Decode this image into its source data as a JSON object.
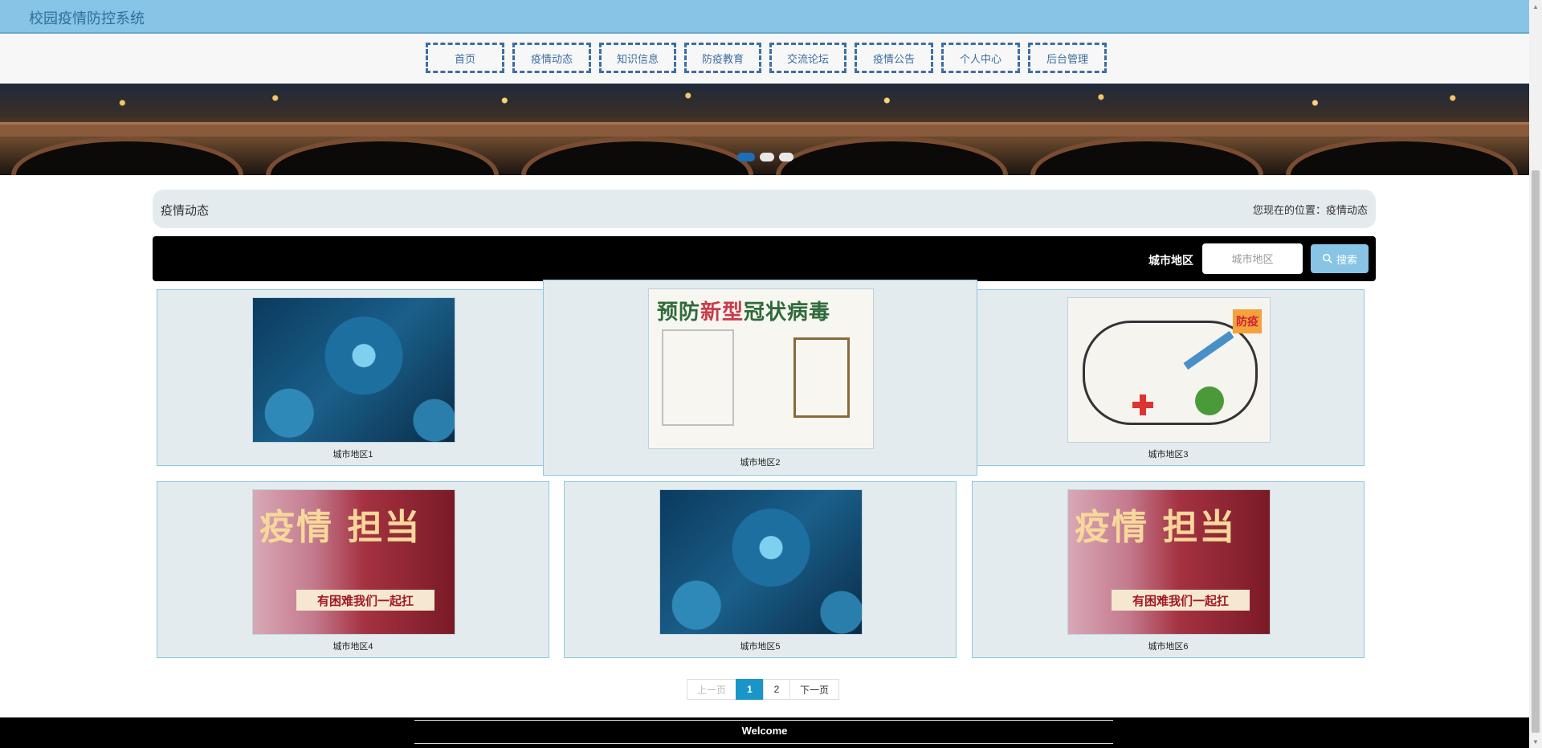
{
  "header": {
    "title": "校园疫情防控系统"
  },
  "nav": {
    "items": [
      {
        "label": "首页"
      },
      {
        "label": "疫情动态"
      },
      {
        "label": "知识信息"
      },
      {
        "label": "防疫教育"
      },
      {
        "label": "交流论坛"
      },
      {
        "label": "疫情公告"
      },
      {
        "label": "个人中心"
      },
      {
        "label": "后台管理"
      }
    ]
  },
  "banner": {
    "slide_count": 3,
    "active_slide": 1
  },
  "breadcrumb": {
    "title": "疫情动态",
    "location": "您现在的位置：疫情动态"
  },
  "search": {
    "label": "城市地区",
    "placeholder": "城市地区",
    "value": "",
    "button_label": "搜索"
  },
  "cards": [
    {
      "caption": "城市地区1",
      "image": "virus-image"
    },
    {
      "caption": "城市地区2",
      "image": "handdrawn-poster-image"
    },
    {
      "caption": "城市地区3",
      "image": "handdrawn-poster-image"
    },
    {
      "caption": "城市地区4",
      "image": "promo-banner-image"
    },
    {
      "caption": "城市地区5",
      "image": "virus-image"
    },
    {
      "caption": "城市地区6",
      "image": "promo-banner-image"
    }
  ],
  "poster": {
    "title_part1": "预防",
    "title_part2": "新型",
    "title_part3": "冠状病毒",
    "tag": "防疫"
  },
  "promo": {
    "headline": "疫情 担当",
    "strip": "有困难我们一起扛"
  },
  "pagination": {
    "prev": "上一页",
    "pages": [
      "1",
      "2"
    ],
    "current": "1",
    "next": "下一页"
  },
  "footer": {
    "text": "Welcome"
  },
  "colors": {
    "header_bg": "#87c4e6",
    "nav_border": "#3d6ea2",
    "card_bg": "#e3ebee",
    "card_border": "#8fc8de",
    "active_page": "#1a95c8",
    "active_dot": "#1a6fb8"
  }
}
